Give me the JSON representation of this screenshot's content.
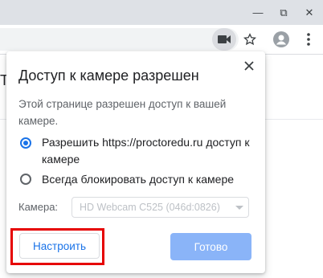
{
  "window_controls": {
    "minimize": "—",
    "maximize": "⧉",
    "close": "✕"
  },
  "icons": {
    "camera": "camera-icon",
    "star": "star-icon",
    "avatar": "account-icon",
    "menu": "more-vert-icon",
    "close": "close-icon"
  },
  "page_fragment": "Т",
  "bubble": {
    "title": "Доступ к камере разрешен",
    "description": "Этой странице разрешен доступ к вашей камере.",
    "options": [
      {
        "label": "Разрешить https://proctoredu.ru доступ к камере",
        "selected": true
      },
      {
        "label": "Всегда блокировать доступ к камере",
        "selected": false
      }
    ],
    "camera_label": "Камера:",
    "camera_selected": "HD Webcam C525 (046d:0826)",
    "configure_button": "Настроить",
    "done_button": "Готово",
    "close_label": "✕"
  },
  "colors": {
    "accent": "#1a73e8",
    "done_button_bg": "#8ab4f8",
    "highlight": "#e60000",
    "titlebar": "#dee1e6"
  }
}
